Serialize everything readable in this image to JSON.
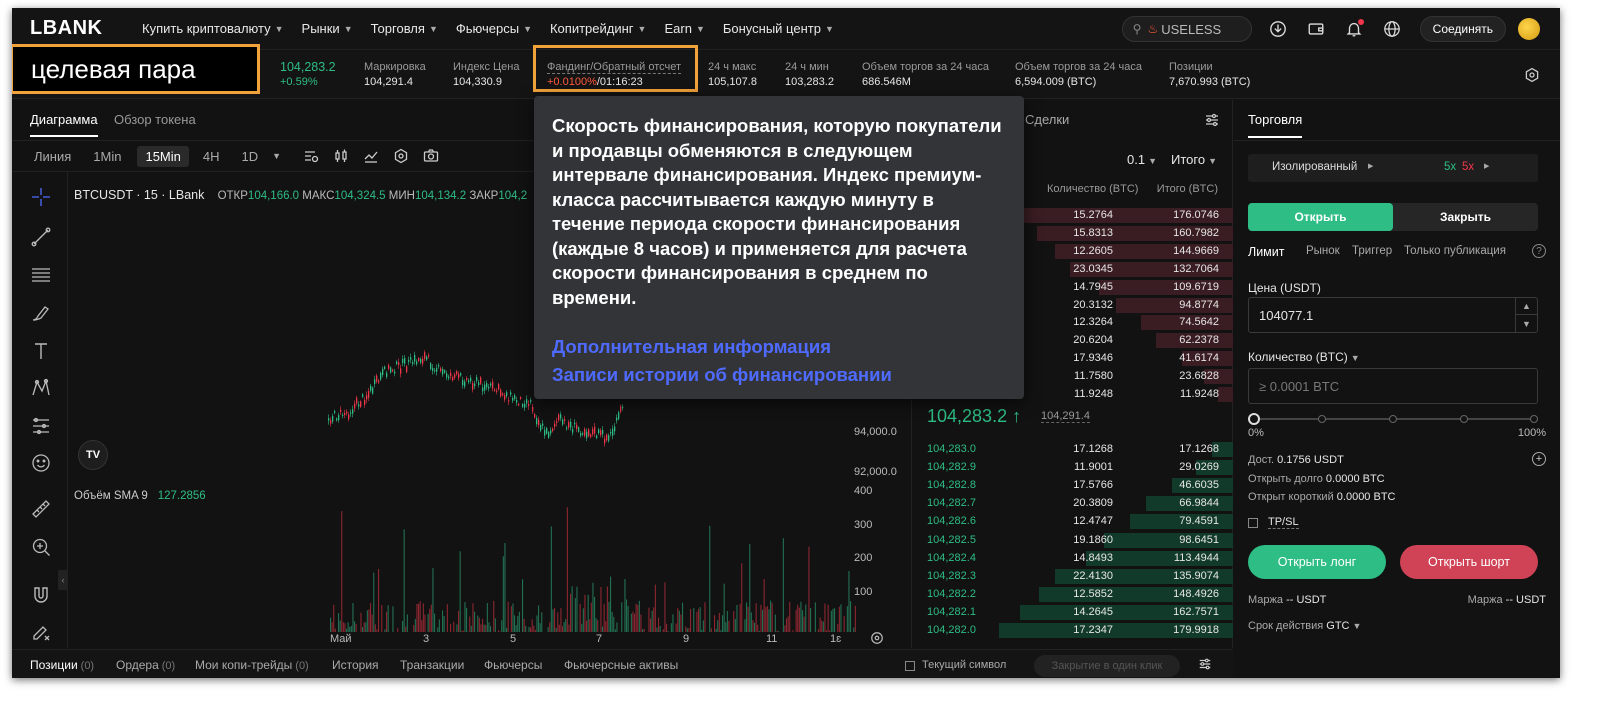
{
  "nav": {
    "logo": "LBANK",
    "items": [
      {
        "label": "Купить криптовалюту",
        "chev": true
      },
      {
        "label": "Рынки",
        "chev": true
      },
      {
        "label": "Торговля",
        "chev": true
      },
      {
        "label": "Фьючерсы",
        "chev": true
      },
      {
        "label": "Копитрейдинг",
        "chev": true
      },
      {
        "label": "Earn",
        "chev": true
      },
      {
        "label": "Бонусный центр",
        "chev": true
      }
    ],
    "search_value": "USELESS",
    "connect_label": "Соединять"
  },
  "ticker": {
    "callout": "целевая пара",
    "last_price": "104,283.2",
    "change": "+0.59%",
    "fields": [
      {
        "label": "Маркировка",
        "value": "104,291.4"
      },
      {
        "label": "Индекс Цена",
        "value": "104,330.9"
      },
      {
        "label": "Фандинг/Обратный отсчет",
        "value_rate": "+0.0100%",
        "value_time": "/01:16:23"
      },
      {
        "label": "24 ч макс",
        "value": "105,107.8"
      },
      {
        "label": "24 ч мин",
        "value": "103,283.2"
      },
      {
        "label": "Объем торгов за 24 часа",
        "value": "686.546M"
      },
      {
        "label": "Объем торгов за 24 часа",
        "value": "6,594.009 (BTC)"
      },
      {
        "label": "Позиции",
        "value": "7,670.993 (BTC)"
      }
    ]
  },
  "chart_panel": {
    "tab_chart": "Диаграмма",
    "tab_overview": "Обзор токена",
    "timeframes": [
      "Линия",
      "1Min",
      "15Min",
      "4H",
      "1D"
    ],
    "active_tf": "15Min",
    "symbol": "BTCUSDT · 15 · LBank",
    "ohlc": {
      "open_label": "ОТКР",
      "open": "104,166.0",
      "high_label": "МАКС",
      "high": "104,324.5",
      "low_label": "МИН",
      "low": "104,134.2",
      "close_label": "ЗАКР",
      "close": "104,2"
    },
    "tv_logo": "TV",
    "volume_label": "Объём SMA 9",
    "volume_value": "127.2856",
    "y_price_ticks": [
      "94,000.0",
      "92,000.0"
    ],
    "y_volume_ticks": [
      "400",
      "300",
      "200",
      "100"
    ],
    "x_ticks": [
      "Май",
      "3",
      "5",
      "7",
      "9",
      "11",
      "1ɛ"
    ]
  },
  "orderbook": {
    "trades_tab": "Сделки",
    "precision": "0.1",
    "total_mode": "Итого",
    "col_qty": "Количество (BTC)",
    "col_total": "Итого (BTC)",
    "asks": [
      {
        "q": "15.2764",
        "t": "176.0746",
        "depth": 0.98
      },
      {
        "q": "15.8313",
        "t": "160.7982",
        "depth": 0.89
      },
      {
        "q": "12.2605",
        "t": "144.9669",
        "depth": 0.81
      },
      {
        "q": "23.0345",
        "t": "132.7064",
        "depth": 0.74
      },
      {
        "q": "14.7945",
        "t": "109.6719",
        "depth": 0.61
      },
      {
        "q": "20.3132",
        "t": "94.8774",
        "depth": 0.53
      },
      {
        "q": "12.3264",
        "t": "74.5642",
        "depth": 0.42
      },
      {
        "q": "20.6204",
        "t": "62.2378",
        "depth": 0.35
      },
      {
        "q": "17.9346",
        "t": "41.6174",
        "depth": 0.23
      },
      {
        "q": "11.7580",
        "t": "23.6828",
        "depth": 0.13
      },
      {
        "q": "11.9248",
        "t": "11.9248",
        "depth": 0.07
      }
    ],
    "mid_price": "104,283.2",
    "mid_arrow": "↑",
    "mark_price": "104,291.4",
    "bids": [
      {
        "p": "104,283.0",
        "q": "17.1268",
        "t": "17.1268",
        "depth": 0.09
      },
      {
        "p": "104,282.9",
        "q": "11.9001",
        "t": "29.0269",
        "depth": 0.16
      },
      {
        "p": "104,282.8",
        "q": "17.5766",
        "t": "46.6035",
        "depth": 0.26
      },
      {
        "p": "104,282.7",
        "q": "20.3809",
        "t": "66.9844",
        "depth": 0.37
      },
      {
        "p": "104,282.6",
        "q": "12.4747",
        "t": "79.4591",
        "depth": 0.44
      },
      {
        "p": "104,282.5",
        "q": "19.1860",
        "t": "98.6451",
        "depth": 0.55
      },
      {
        "p": "104,282.4",
        "q": "14.8493",
        "t": "113.4944",
        "depth": 0.63
      },
      {
        "p": "104,282.3",
        "q": "22.4130",
        "t": "135.9074",
        "depth": 0.76
      },
      {
        "p": "104,282.2",
        "q": "12.5852",
        "t": "148.4926",
        "depth": 0.83
      },
      {
        "p": "104,282.1",
        "q": "14.2645",
        "t": "162.7571",
        "depth": 0.91
      },
      {
        "p": "104,282.0",
        "q": "17.2347",
        "t": "179.9918",
        "depth": 1.0
      }
    ]
  },
  "trade": {
    "title": "Торговля",
    "margin_mode": "Изолированный",
    "lev_long": "5x",
    "lev_short": "5x",
    "open_label": "Открыть",
    "close_label": "Закрыть",
    "order_types": [
      "Лимит",
      "Рынок",
      "Триггер",
      "Только публикация"
    ],
    "price_label": "Цена (USDT)",
    "price_value": "104077.1",
    "qty_label": "Количество (BTC)",
    "qty_placeholder": "≥ 0.0001 BTC",
    "slider_fraction": 0,
    "pct_min": "0%",
    "pct_max": "100%",
    "avail_label": "Дост.",
    "avail_value": "0.1756 USDT",
    "open_long_label": "Открыть долго",
    "open_long_value": "0.0000 BTC",
    "open_short_label": "Открыт короткий",
    "open_short_value": "0.0000 BTC",
    "tpsl": "TP/SL",
    "btn_long": "Открыть лонг",
    "btn_short": "Открыть шорт",
    "margin_long_label": "Маржа",
    "margin_long_value": "-- USDT",
    "margin_short_label": "Маржа",
    "margin_short_value": "-- USDT",
    "validity_label": "Срок действия",
    "validity_value": "GTC"
  },
  "bottom": {
    "tabs": [
      {
        "label": "Позиции",
        "count": "(0)"
      },
      {
        "label": "Ордера",
        "count": "(0)"
      },
      {
        "label": "Мои копи-трейды",
        "count": "(0)"
      },
      {
        "label": "История",
        "count": ""
      },
      {
        "label": "Транзакции",
        "count": ""
      },
      {
        "label": "Фьючерсы",
        "count": ""
      },
      {
        "label": "Фьючерсные активы",
        "count": ""
      }
    ],
    "current_symbol": "Текущий символ",
    "close_all": "Закрытие в один клик"
  },
  "tooltip": {
    "text": "Скорость финансирования, которую покупатели и продавцы обменяются в следующем интервале финансирования. Индекс премиум-класса рассчитывается каждую минуту в течение периода скорости финансирования (каждые 8 часов) и применяется для расчета скорости финансирования в среднем по времени.",
    "link1": "Дополнительная информация",
    "link2": "Записи истории об финансировании"
  },
  "colors": {
    "up": "#2ebd85",
    "down": "#f0364a",
    "highlight": "#f2a23a",
    "link": "#4f6bff"
  }
}
